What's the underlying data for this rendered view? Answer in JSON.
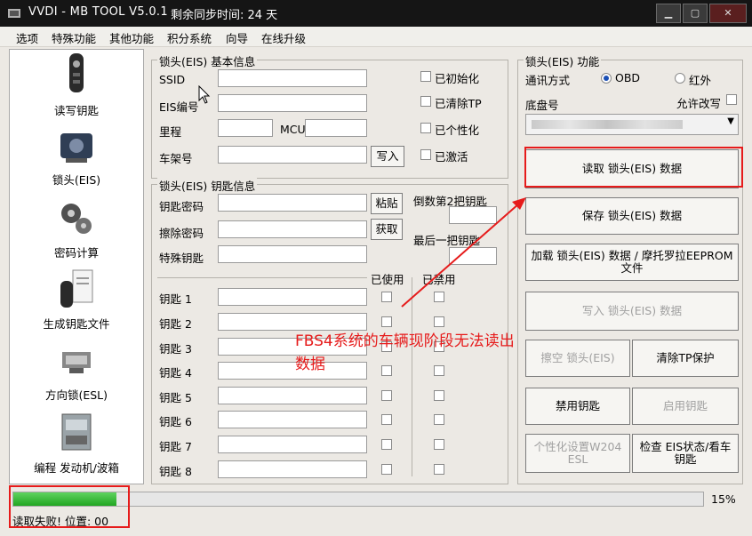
{
  "titlebar": {
    "title": "VVDI - MB TOOL V5.0.1",
    "sync_text": "剩余同步时间: 24 天"
  },
  "menu": [
    "选项",
    "特殊功能",
    "其他功能",
    "积分系统",
    "向导",
    "在线升级"
  ],
  "sidebar": {
    "items": [
      {
        "label": "读写钥匙",
        "icon": "car-key-icon"
      },
      {
        "label": "锁头(EIS)",
        "icon": "eis-module-icon"
      },
      {
        "label": "密码计算",
        "icon": "gears-icon"
      },
      {
        "label": "生成钥匙文件",
        "icon": "key-file-icon"
      },
      {
        "label": "方向锁(ESL)",
        "icon": "steering-lock-icon"
      },
      {
        "label": "编程 发动机/波箱",
        "icon": "ecu-icon"
      }
    ]
  },
  "eis_basic": {
    "title": "锁头(EIS) 基本信息",
    "ssid_label": "SSID",
    "eis_no_label": "EIS编号",
    "mileage_label": "里程",
    "mcu_label": "MCU",
    "vin_label": "车架号",
    "write_button": "写入",
    "checks": [
      "已初始化",
      "已清除TP",
      "已个性化",
      "已激活"
    ]
  },
  "key_info": {
    "title": "锁头(EIS) 钥匙信息",
    "key_password_label": "钥匙密码",
    "erase_password_label": "擦除密码",
    "special_key_label": "特殊钥匙",
    "paste_button": "粘贴",
    "get_button": "获取",
    "countdown_label": "倒数第2把钥匙",
    "last_key_label": "最后一把钥匙",
    "used_header": "已使用",
    "disabled_header": "已禁用",
    "keys": [
      "钥匙 1",
      "钥匙 2",
      "钥匙 3",
      "钥匙 4",
      "钥匙 5",
      "钥匙 6",
      "钥匙 7",
      "钥匙 8"
    ]
  },
  "eis_func": {
    "title": "锁头(EIS) 功能",
    "comm_label": "通讯方式",
    "obd_label": "OBD",
    "ir_label": "红外",
    "chassis_label": "底盘号",
    "allow_modify_label": "允许改写",
    "buttons": {
      "read": "读取 锁头(EIS) 数据",
      "save": "保存 锁头(EIS) 数据",
      "load": "加载 锁头(EIS) 数据 / 摩托罗拉EEPROM 文件",
      "write": "写入 锁头(EIS) 数据",
      "erase": "擦空 锁头(EIS)",
      "clear_tp": "清除TP保护",
      "disable_key": "禁用钥匙",
      "enable_key": "启用钥匙",
      "personalize": "个性化设置W204 ESL",
      "check": "检查 EIS状态/看车钥匙"
    }
  },
  "annotation": {
    "text_line1": "FBS4系统的车辆现阶段无法读出",
    "text_line2": "数据",
    "color": "#e61b1b"
  },
  "progress": {
    "value": 15,
    "label": "15%"
  },
  "status": {
    "text": "读取失败! 位置: 00"
  }
}
